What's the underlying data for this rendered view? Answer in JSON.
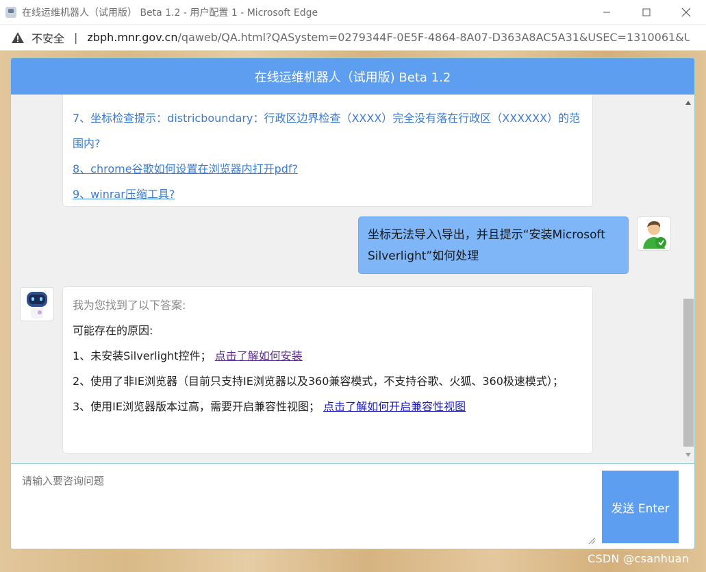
{
  "window": {
    "title": "在线运维机器人（试用版）  Beta 1.2 - 用户配置 1 - Microsoft Edge"
  },
  "addressbar": {
    "security_label": "不安全",
    "separator": "|",
    "url_host": "zbph.mnr.gov.cn",
    "url_path": "/qaweb/QA.html?QASystem=0279344F-0E5F-4864-8A07-D363A8AC5A31&USEC=1310061&U..."
  },
  "chat": {
    "header_title": "在线运维机器人（试用版) Beta 1.2",
    "prev_bot_links": [
      "7、坐标检查提示：districboundary：行政区边界检查（XXXX）完全没有落在行政区（XXXXXX）的范围内?",
      "8、chrome谷歌如何设置在浏览器内打开pdf?",
      "9、winrar压缩工具?"
    ],
    "user_message": "坐标无法导入\\导出，并且提示“安装Microsoft Silverlight”如何处理",
    "bot_reply": {
      "greeting": "我为您找到了以下答案:",
      "heading": "可能存在的原因:",
      "item1_text": "1、未安装Silverlight控件；",
      "item1_link": "点击了解如何安装",
      "item2_text": "2、使用了非IE浏览器（目前只支持IE浏览器以及360兼容模式，不支持谷歌、火狐、360极速模式）；",
      "item3_text": "3、使用IE浏览器版本过高，需要开启兼容性视图；",
      "item3_link": "点击了解如何开启兼容性视图"
    }
  },
  "input": {
    "placeholder": "请输入要咨询问题",
    "value": "",
    "send_label": "发送 Enter"
  },
  "watermark": "CSDN @csanhuan",
  "colors": {
    "accent": "#5d9ef1",
    "user_bubble": "#7eb6f7",
    "link": "#3a7bd5"
  }
}
